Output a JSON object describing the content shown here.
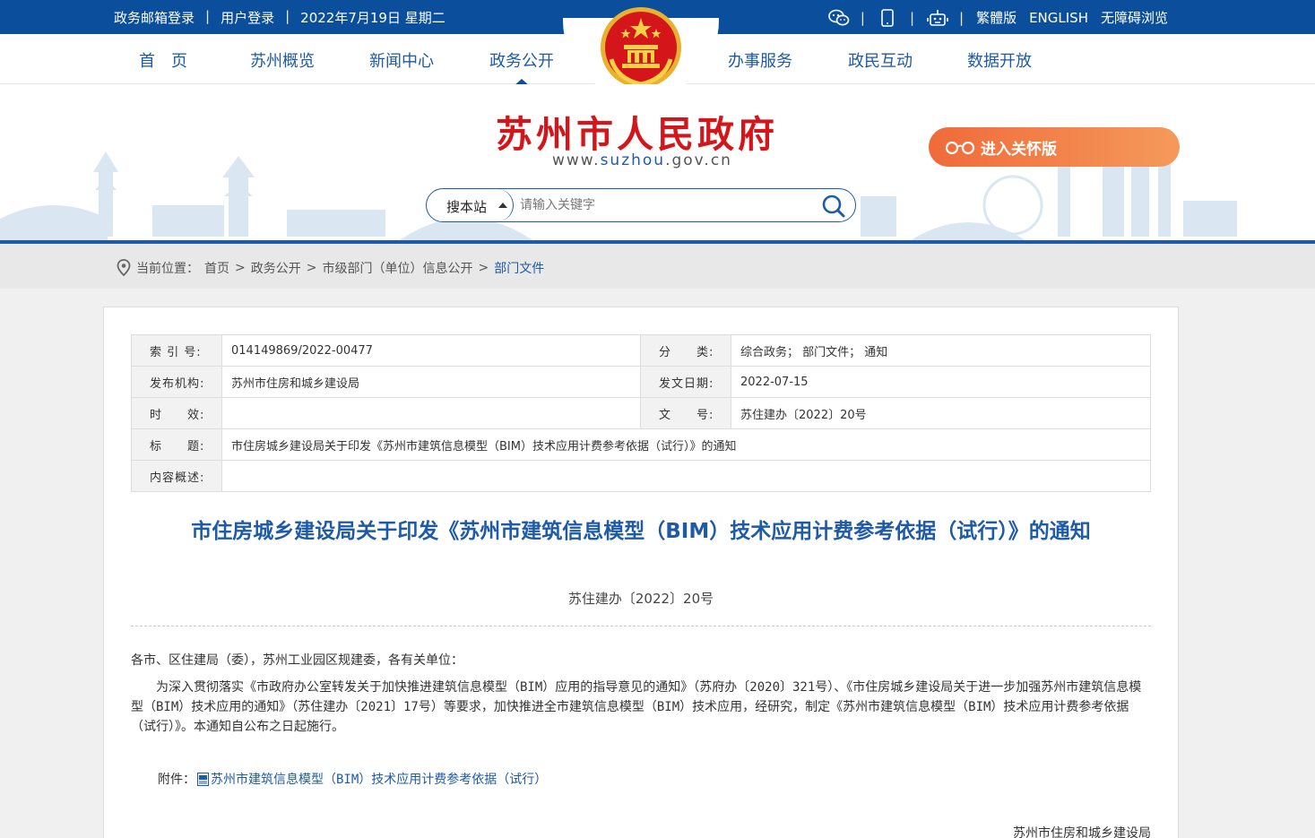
{
  "topbar": {
    "mail_login": "政务邮箱登录",
    "user_login": "用户登录",
    "date": "2022年7月19日 星期二",
    "traditional": "繁體版",
    "english": "ENGLISH",
    "accessible": "无障碍浏览",
    "separator": "|",
    "icons": [
      "wechat-icon",
      "mobile-icon",
      "robot-icon"
    ]
  },
  "nav": {
    "items": [
      {
        "label": "首　页"
      },
      {
        "label": "苏州概览"
      },
      {
        "label": "新闻中心"
      },
      {
        "label": "政务公开"
      },
      {
        "label": "办事服务"
      },
      {
        "label": "政民互动"
      },
      {
        "label": "数据开放"
      }
    ],
    "active_index": 3
  },
  "header": {
    "site_title": "苏州市人民政府",
    "url_prefix": "www.",
    "url_domain": "suzhou",
    "url_suffix": ".gov.cn",
    "care_label": "进入关怀版",
    "search_scope": "搜本站",
    "search_placeholder": "请输入关键字"
  },
  "breadcrumb": {
    "prefix": "当前位置：",
    "items": [
      "首页",
      "政务公开",
      "市级部门（单位）信息公开"
    ],
    "current": "部门文件",
    "sep": ">"
  },
  "meta": {
    "index_no_label": "索 引 号:",
    "index_no": "014149869/2022-00477",
    "category_label": "分　　类:",
    "category": "综合政务；  部门文件；  通知",
    "publisher_label": "发布机构:",
    "publisher": "苏州市住房和城乡建设局",
    "date_label": "发文日期:",
    "date": "2022-07-15",
    "validity_label": "时　　效:",
    "validity": "",
    "docno_label": "文　　号:",
    "docno": "苏住建办〔2022〕20号",
    "title_label": "标　　题:",
    "title": "市住房城乡建设局关于印发《苏州市建筑信息模型（BIM）技术应用计费参考依据（试行）》的通知",
    "summary_label": "内容概述:",
    "summary": ""
  },
  "document": {
    "title": "市住房城乡建设局关于印发《苏州市建筑信息模型（BIM）技术应用计费参考依据（试行）》的通知",
    "doc_number": "苏住建办〔2022〕20号",
    "salutation": "各市、区住建局（委），苏州工业园区规建委，各有关单位：",
    "paragraph": "为深入贯彻落实《市政府办公室转发关于加快推进建筑信息模型（BIM）应用的指导意见的通知》（苏府办〔2020〕321号）、《市住房城乡建设局关于进一步加强苏州市建筑信息模型（BIM）技术应用的通知》（苏住建办〔2021〕17号）等要求，加快推进全市建筑信息模型（BIM）技术应用，经研究，制定《苏州市建筑信息模型（BIM）技术应用计费参考依据（试行）》。本通知自公布之日起施行。",
    "attachment_label": "附件：",
    "attachment_name": "苏州市建筑信息模型（BIM）技术应用计费参考依据（试行）",
    "signature": "苏州市住房和城乡建设局"
  },
  "colors": {
    "brand_blue": "#0b4f9c",
    "title_red": "#d4161b",
    "care_orange": "#f06a3a"
  }
}
